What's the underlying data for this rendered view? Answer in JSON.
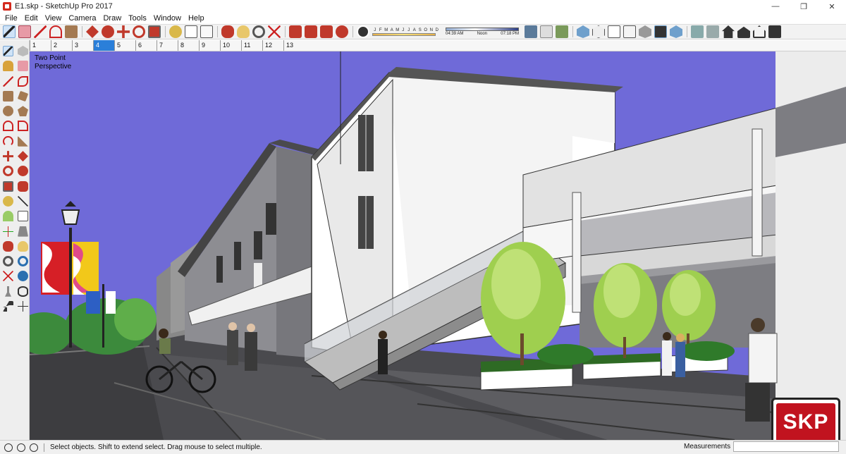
{
  "window": {
    "title": "E1.skp - SketchUp Pro 2017",
    "minimize": "—",
    "maximize": "❐",
    "close": "✕"
  },
  "menu": [
    "File",
    "Edit",
    "View",
    "Camera",
    "Draw",
    "Tools",
    "Window",
    "Help"
  ],
  "toolbar": {
    "months": [
      "J",
      "F",
      "M",
      "A",
      "M",
      "J",
      "J",
      "A",
      "S",
      "O",
      "N",
      "D"
    ],
    "time_left": "04:39 AM",
    "time_mid": "Noon",
    "time_right": "07:18 PM"
  },
  "scene_tabs": [
    "1",
    "2",
    "3",
    "4",
    "5",
    "6",
    "7",
    "8",
    "9",
    "10",
    "11",
    "12",
    "13"
  ],
  "active_tab_index": 3,
  "viewport": {
    "camera_line1": "Two Point",
    "camera_line2": "Perspective",
    "logo_text": "SKP"
  },
  "status": {
    "message": "Select objects. Shift to extend select. Drag mouse to select multiple.",
    "measurements_label": "Measurements",
    "measurements_value": ""
  },
  "colors": {
    "sky": "#6f6ad8",
    "accent_tab": "#2b7fd9",
    "logo_red": "#c1131f"
  }
}
